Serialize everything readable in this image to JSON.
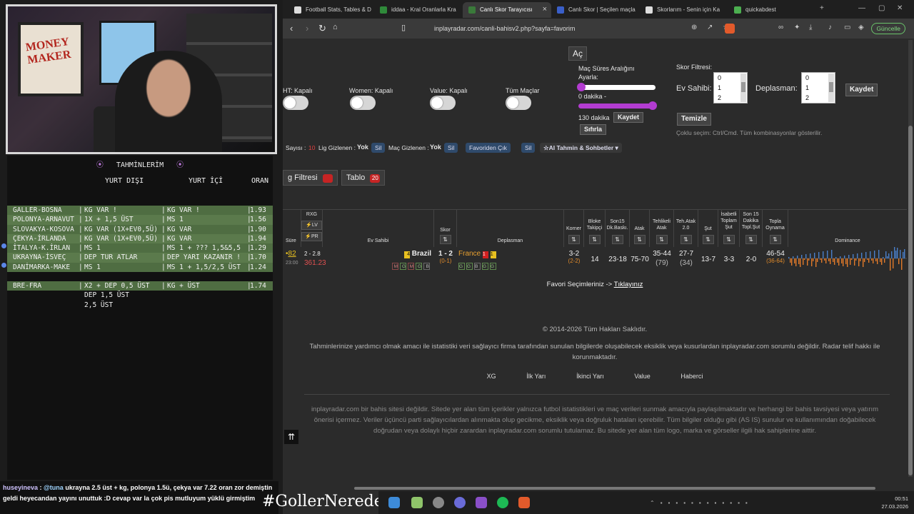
{
  "predictions": {
    "title": "TAHMİNLERİM",
    "col_away": "YURT DIŞI",
    "col_home": "YURT İÇİ",
    "col_odds": "ORAN",
    "rows": [
      {
        "match": "GALLER-BOSNA",
        "abroad": "KG VAR !",
        "home": "KG VAR !",
        "odds": "1.93",
        "dot": false
      },
      {
        "match": "POLONYA-ARNAVUT",
        "abroad": "1X + 1,5 ÜST",
        "home": "MS 1",
        "odds": "1.56",
        "dot": false
      },
      {
        "match": "SLOVAKYA-KOSOVA",
        "abroad": "KG VAR (1X+EV0,5Ü)",
        "home": "KG VAR",
        "odds": "1.90",
        "dot": false
      },
      {
        "match": "ÇEKYA-İRLANDA",
        "abroad": "KG VAR (1X+EV0,5Ü)",
        "home": "KG VAR",
        "odds": "1.94",
        "dot": false
      },
      {
        "match": "İTALYA-K.İRLAN",
        "abroad": "MS 1",
        "home": "MS 1 + ??? 1,5&5,5",
        "odds": "1.29",
        "dot": true
      },
      {
        "match": "UKRAYNA-İSVEÇ",
        "abroad": "DEP TUR ATLAR",
        "home": "DEP YARI KAZANIR !",
        "odds": "1.70",
        "dot": false
      },
      {
        "match": "DANİMARKA-MAKE",
        "abroad": "MS 1",
        "home": "MS 1 + 1,5/2,5 ÜST",
        "odds": "1.24",
        "dot": true
      }
    ],
    "extra": {
      "match": "BRE-FRA",
      "abroad": "X2 + DEP 0,5 ÜST",
      "home": "KG + ÜST",
      "odds": "1.74",
      "line2": "DEP 1,5 ÜST",
      "line3": "2,5 ÜST"
    }
  },
  "chat": {
    "user": "huseyineva",
    "mention": "@tuna",
    "message": "ukrayna 2.5 üst + kg, polonya 1.5ü, çekya var 7.22 oran zor demiştin geldi heyecandan yayını unuttuk :D cevap var la çok pis mutluyum yüklü girmiştim"
  },
  "hashtag": "#GollerNerede",
  "browser": {
    "tabs": [
      {
        "label": "Football Stats, Tables & D",
        "color": "#dddddd",
        "active": false
      },
      {
        "label": "iddaa - Kral Oranlarla Kra",
        "color": "#2f8a3a",
        "active": false
      },
      {
        "label": "Canlı Skor Tarayıcısı",
        "color": "#3a7a3a",
        "active": true
      },
      {
        "label": "Canlı Skor | Seçilen maçla",
        "color": "#3a5fc9",
        "active": false
      },
      {
        "label": "Skorlarım - Senin için Ka",
        "color": "#dddddd",
        "active": false
      },
      {
        "label": "quickabdest",
        "color": "#4caf50",
        "active": false
      }
    ],
    "url": "inplayradar.com/canli-bahisv2.php?sayfa=favorim",
    "update_label": "Güncelle"
  },
  "page": {
    "ac_label": "Aç",
    "toggles": [
      {
        "label": "HT: Kapalı"
      },
      {
        "label": "Women: Kapalı"
      },
      {
        "label": "Value: Kapalı"
      },
      {
        "label": "Tüm Maçlar"
      }
    ],
    "time_range": {
      "title": "Maç Süres Aralığını Ayarla:",
      "min_label": "0 dakika -",
      "max_label": "130 dakika",
      "save": "Kaydet",
      "reset": "Sıfırla",
      "min_value": 0,
      "max_value": 130
    },
    "score_filter": {
      "title": "Skor Filtresi:",
      "home_label": "Ev Sahibi:",
      "away_label": "Deplasman:",
      "home_options": [
        "0",
        "1",
        "2"
      ],
      "away_options": [
        "0",
        "1",
        "2"
      ],
      "save": "Kaydet",
      "clear": "Temizle",
      "hint": "Çoklu seçim: Ctrl/Cmd. Tüm kombinasyonlar gösterilir."
    },
    "chips": {
      "count_label": "Sayısı :",
      "league_hidden_label": "Lig Gizlenen :",
      "league_hidden_value": "Yok",
      "delete1": "Sil",
      "match_hidden_label": "Maç Gizlenen :",
      "match_hidden_value": "Yok",
      "delete2": "Sil",
      "fav_out": "Favoriden Çık",
      "delete3": "Sil",
      "ai": "AI Tahmin & Sohbetler"
    },
    "filter_btn": "g Filtresi",
    "table_btn": "Tablo",
    "table_count": "20",
    "headers": {
      "sure": "Süre",
      "rxg": "RXG",
      "lv": "LV",
      "pr": "PR",
      "ev": "Ev Sahibi",
      "skor": "Skor",
      "dep": "Deplasman",
      "korner": "Korner",
      "bloke": "Bloke Takipçi",
      "son15": "Son15 Dk.Baskı.",
      "atak": "Atak",
      "tehlikeli": "Tehlikeli Atak",
      "tehatak": "Teh.Atak 2.0",
      "sut": "Şut",
      "isabetli": "İsabetli Toplam Şut",
      "son15sut": "Son 15 Dakika Topl.Şut",
      "topla": "Topla Oynama",
      "dominance": "Dominance"
    },
    "match": {
      "minute": "82",
      "clock": "23:00",
      "line": "2 - 2.8",
      "rxg": "361.23",
      "home": "Brazil",
      "home_yellow": "4",
      "score": "1 - 2",
      "ht_score": "(0-1)",
      "away": "France",
      "away_red": "1",
      "away_yellow": "1",
      "home_form": [
        "M",
        "G",
        "M",
        "G",
        "B"
      ],
      "away_form": [
        "G",
        "G",
        "B",
        "G",
        "G"
      ],
      "korner": "3-2",
      "korner_ht": "(2-2)",
      "bloke": "14",
      "son15": "23-18",
      "atak": "75-70",
      "tehlikeli": "35-44",
      "tehlikeli_sub": "(79)",
      "tehatak": "27-7",
      "tehatak_sub": "(34)",
      "sut": "13-7",
      "isabetli": "3-3",
      "son15sut": "2-0",
      "topla": "46-54",
      "topla_sub": "(36-64)"
    },
    "fav_note": "Favori Seçimleriniz ->",
    "fav_link": "Tıklayınız",
    "copyright": "© 2014-2026 Tüm Hakları Saklıdır.",
    "disclaimer": "Tahminlerinize yardımcı olmak amacı ile istatistiki veri sağlayıcı firma tarafından sunulan bilgilerde oluşabilecek eksiklik veya kusurlardan inplayradar.com sorumlu değildir. Radar telif hakkı ile korunmaktadır.",
    "links": [
      "XG",
      "İlk Yarı",
      "İkinci Yarı",
      "Value",
      "Haberci"
    ],
    "legal": "inplayradar.com bir bahis sitesi değildir. Sitede yer alan tüm içerikler yalnızca futbol istatistikleri ve maç verileri sunmak amacıyla paylaşılmaktadır ve herhangi bir bahis tavsiyesi veya yatırım önerisi içermez. Veriler üçüncü parti sağlayıcılardan alınmakta olup gecikme, eksiklik veya doğruluk hataları içerebilir. Tüm bilgiler olduğu gibi (AS IS) sunulur ve kullanımından doğabilecek doğrudan veya dolaylı hiçbir zarardan inplayradar.com sorumlu tutulamaz. Bu sitede yer alan tüm logo, marka ve görseller ilgili hak sahiplerine aittir."
  },
  "webcam": {
    "poster_text": "MONEY MAKER"
  },
  "clock": {
    "time": "00:51",
    "date": "27.03.2026"
  },
  "colors": {
    "accent": "#b33cd1",
    "home_bar": "#e07a2a",
    "away_bar": "#4a7fc9"
  }
}
